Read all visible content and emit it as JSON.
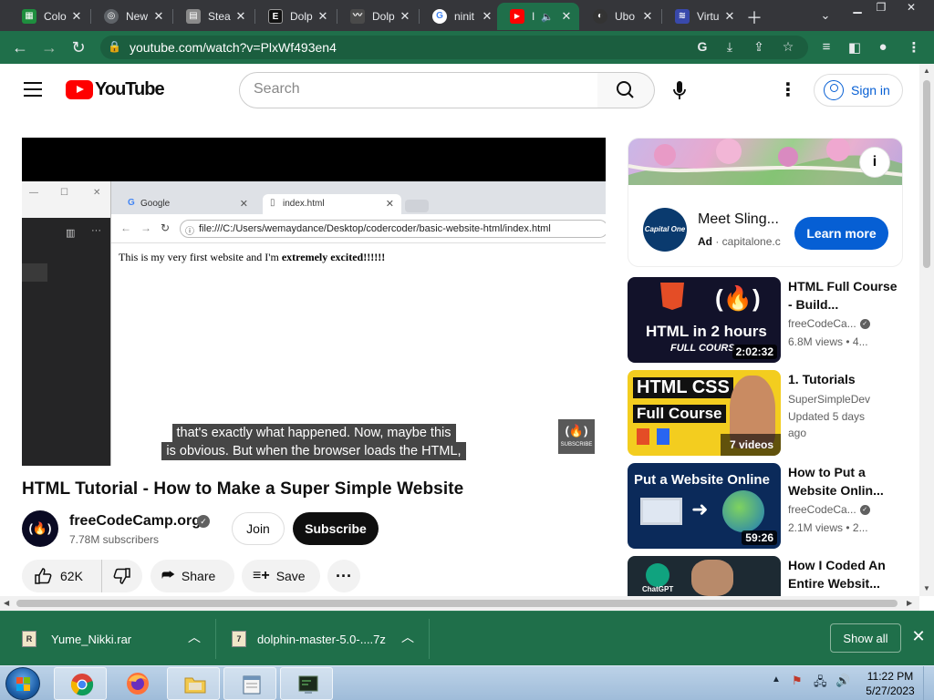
{
  "browser": {
    "tabs": [
      {
        "title": "Colo",
        "fav_color": "#1e8e3e",
        "fav_glyph": "▦",
        "fav_name": "sheets-icon"
      },
      {
        "title": "New",
        "fav_color": "#5f6368",
        "fav_glyph": "◎",
        "fav_name": "chrome-icon"
      },
      {
        "title": "Stea",
        "fav_color": "#8a8a8a",
        "fav_glyph": "▤",
        "fav_name": "store-icon"
      },
      {
        "title": "Dolp",
        "fav_color": "#111111",
        "fav_glyph": "E",
        "fav_name": "site-icon"
      },
      {
        "title": "Dolp",
        "fav_color": "#4a4a4a",
        "fav_glyph": "〰",
        "fav_name": "dolphin-icon"
      },
      {
        "title": "ninit",
        "fav_color": "#ffffff",
        "fav_glyph": "G",
        "fav_name": "google-icon"
      },
      {
        "title": "I",
        "fav_color": "#ff0000",
        "fav_glyph": "▶",
        "fav_name": "youtube-icon"
      },
      {
        "title": "Ubo",
        "fav_color": "#333333",
        "fav_glyph": "◐",
        "fav_name": "ubo-icon"
      },
      {
        "title": "Virtu",
        "fav_color": "#3949ab",
        "fav_glyph": "≋",
        "fav_name": "virtual-icon"
      }
    ],
    "url": "youtube.com/watch?v=PlxWf493en4"
  },
  "youtube": {
    "logo_text": "YouTube",
    "search_placeholder": "Search",
    "signin_label": "Sign in"
  },
  "player": {
    "inner_tabs": [
      "Google",
      "index.html"
    ],
    "inner_url": "file:///C:/Users/wemaydance/Desktop/codercoder/basic-website-html/index.html",
    "inner_text_plain": "This is my very first website and I'm ",
    "inner_text_bold": "extremely excited!!!!!!",
    "caption_line1": "that's exactly what happened. Now, maybe this",
    "caption_line2": "is obvious. But when the browser loads the HTML,",
    "watermark_glyph": "(🔥)",
    "watermark_text": "SUBSCRIBE"
  },
  "video": {
    "title": "HTML Tutorial - How to Make a Super Simple Website",
    "avatar_glyph": "(🔥)",
    "channel_name": "freeCodeCamp.org",
    "subscribers": "7.78M subscribers",
    "join_label": "Join",
    "subscribe_label": "Subscribe",
    "likes": "62K",
    "share_label": "Share",
    "save_label": "Save"
  },
  "ad": {
    "logo_text": "Capital One",
    "title": "Meet Sling...",
    "badge": "Ad",
    "sponsor": "capitalone.c",
    "cta": "Learn more"
  },
  "recommendations": [
    {
      "title": "HTML Full Course - Build...",
      "channel": "freeCodeCa...",
      "verified": true,
      "views": "6.8M views",
      "meta": "4...",
      "duration": "2:02:32",
      "thumb_line1": "HTML in 2 hours",
      "thumb_line2": "FULL COURS"
    },
    {
      "title": "1. Tutorials",
      "channel": "SuperSimpleDev",
      "verified": false,
      "views": "Updated 5 days",
      "meta": "ago",
      "duration": "7 videos",
      "thumb_line1": "HTML CSS",
      "thumb_line2": "Full Course"
    },
    {
      "title": "How to Put a Website Onlin...",
      "channel": "freeCodeCa...",
      "verified": true,
      "views": "2.1M views",
      "meta": "2...",
      "duration": "59:26",
      "thumb_line1": "Put a Website Online",
      "thumb_line2": ""
    },
    {
      "title": "How I Coded An Entire Websit...",
      "channel": "",
      "verified": false,
      "views": "",
      "meta": "",
      "duration": "",
      "thumb_line1": "",
      "thumb_line2": "ChatGPT"
    }
  ],
  "downloads": [
    {
      "name": "Yume_Nikki.rar",
      "icon": "R"
    },
    {
      "name": "dolphin-master-5.0-....7z",
      "icon": "7"
    }
  ],
  "show_all_label": "Show all",
  "taskbar": {
    "time": "11:22 PM",
    "date": "5/27/2023"
  }
}
